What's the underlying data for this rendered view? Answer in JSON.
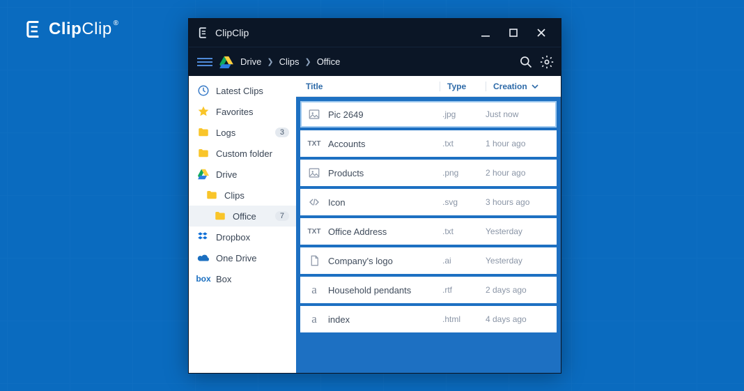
{
  "brand": {
    "text1": "Clip",
    "text2": "Clip"
  },
  "window": {
    "title": "ClipClip"
  },
  "toolbar": {
    "breadcrumbs": [
      "Drive",
      "Clips",
      "Office"
    ]
  },
  "sidebar": {
    "items": [
      {
        "icon": "clock",
        "label": "Latest Clips"
      },
      {
        "icon": "star",
        "label": "Favorites"
      },
      {
        "icon": "folder",
        "label": "Logs",
        "badge": "3"
      },
      {
        "icon": "folder",
        "label": "Custom folder"
      },
      {
        "icon": "gdrive",
        "label": "Drive"
      },
      {
        "icon": "folder",
        "label": "Clips",
        "depth": 1
      },
      {
        "icon": "folder",
        "label": "Office",
        "depth": 2,
        "badge": "7",
        "selected": true
      },
      {
        "icon": "dropbox",
        "label": "Dropbox"
      },
      {
        "icon": "onedrive",
        "label": "One Drive"
      },
      {
        "icon": "box",
        "label": "Box"
      }
    ]
  },
  "columns": {
    "title": "Title",
    "type": "Type",
    "creation": "Creation"
  },
  "rows": [
    {
      "icon": "img",
      "title": "Pic 2649",
      "type": ".jpg",
      "time": "Just now",
      "selected": true
    },
    {
      "icon": "txt",
      "title": "Accounts",
      "type": ".txt",
      "time": "1 hour ago"
    },
    {
      "icon": "img",
      "title": "Products",
      "type": ".png",
      "time": "2 hour ago"
    },
    {
      "icon": "code",
      "title": "Icon",
      "type": ".svg",
      "time": "3 hours ago"
    },
    {
      "icon": "txt",
      "title": "Office Address",
      "type": ".txt",
      "time": "Yesterday"
    },
    {
      "icon": "doc",
      "title": "Company's logo",
      "type": ".ai",
      "time": "Yesterday"
    },
    {
      "icon": "a",
      "title": "Household pendants",
      "type": ".rtf",
      "time": "2 days ago"
    },
    {
      "icon": "a",
      "title": "index",
      "type": ".html",
      "time": "4 days ago"
    }
  ]
}
